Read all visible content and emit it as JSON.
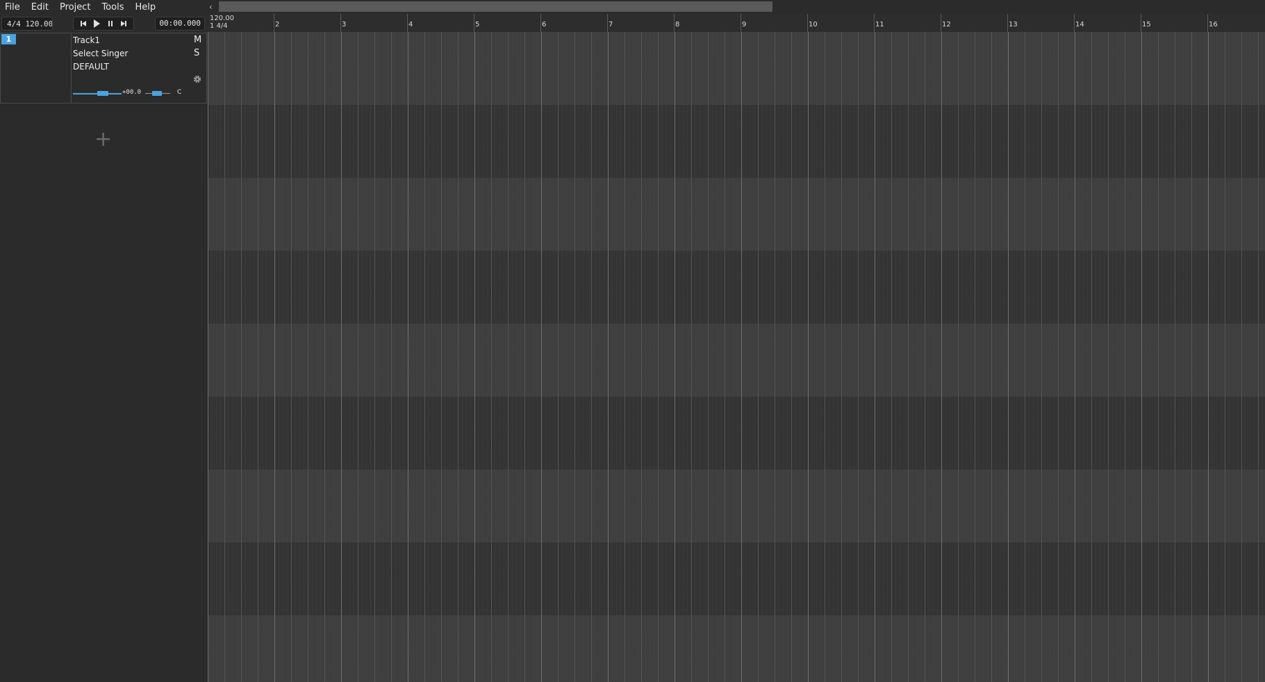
{
  "menu": [
    "File",
    "Edit",
    "Project",
    "Tools",
    "Help"
  ],
  "toolbar": {
    "tempo_text": "4/4  120.00",
    "time": "00:00.000",
    "transport": [
      "skip-back-icon",
      "play-icon",
      "pause-icon",
      "skip-forward-icon"
    ]
  },
  "track": {
    "number": "1",
    "name": "Track1",
    "singer": "Select Singer",
    "renderer": "DEFAULT",
    "mute": "M",
    "solo": "S",
    "volume": "+00.0",
    "pan": "C"
  },
  "ruler": {
    "tempo": "120.00",
    "signature": "1 4/4",
    "bars": [
      "2",
      "3",
      "4",
      "5",
      "6",
      "7",
      "8",
      "9",
      "10",
      "11",
      "12",
      "13",
      "14",
      "15",
      "16"
    ]
  },
  "colors": {
    "accent": "#4aa3df",
    "background": "#2b2b2b"
  }
}
